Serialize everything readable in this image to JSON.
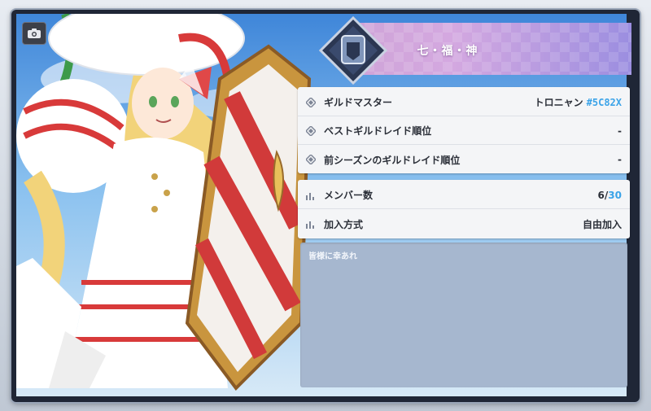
{
  "guild": {
    "name": "七・福・神"
  },
  "info": {
    "rows": [
      {
        "label": "ギルドマスター",
        "value": "トロニャン",
        "id": "#5C82X",
        "icon": "diamond-icon"
      },
      {
        "label": "ベストギルドレイド順位",
        "value": "-",
        "icon": "diamond-icon"
      },
      {
        "label": "前シーズンのギルドレイド順位",
        "value": "-",
        "icon": "diamond-icon"
      }
    ]
  },
  "members": {
    "label": "メンバー数",
    "current": "6",
    "separator": "/",
    "max": "30",
    "icon": "bar-chart-icon"
  },
  "join": {
    "label": "加入方式",
    "value": "自由加入",
    "icon": "bar-chart-icon"
  },
  "description": "皆様に幸あれ",
  "icons": {
    "camera": "camera-icon",
    "emblem": "shield-emblem-icon"
  },
  "colors": {
    "accent_blue": "#3aa3e8",
    "banner_pink": "#d4a8e0",
    "banner_purple": "#9b8ee0",
    "description_bg": "#a6b7cf"
  }
}
